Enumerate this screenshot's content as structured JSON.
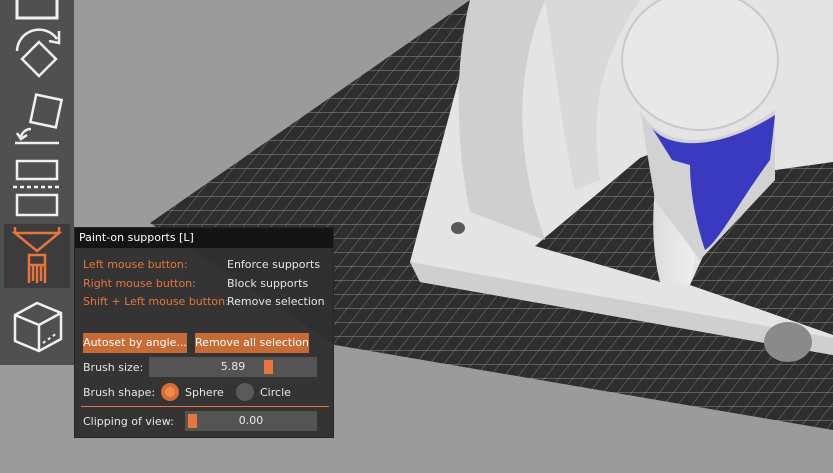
{
  "panel": {
    "title": "Paint-on supports [L]",
    "hints": [
      {
        "key": "Left mouse button:",
        "value": "Enforce supports"
      },
      {
        "key": "Right mouse button:",
        "value": "Block supports"
      },
      {
        "key": "Shift + Left mouse button:",
        "value": "Remove selection"
      }
    ],
    "autoset_label": "Autoset by angle...",
    "remove_all_label": "Remove all selection",
    "brush_size_label": "Brush size:",
    "brush_size_value": "5.89",
    "brush_size_fraction": 0.72,
    "brush_shape_label": "Brush shape:",
    "shape_options": [
      "Sphere",
      "Circle"
    ],
    "selected_shape": "Sphere",
    "clipping_label": "Clipping of view:",
    "clipping_value": "0.00",
    "clipping_fraction": 0.0
  },
  "toolbar": {
    "tools": [
      "move-icon",
      "rotate-icon",
      "place-on-face-icon",
      "cut-icon",
      "paint-supports-icon",
      "seam-icon"
    ],
    "active_tool": "paint-supports-icon"
  },
  "colors": {
    "accent": "#e8753a",
    "toolbar_bg": "#505050",
    "panel_bg": "#303030",
    "bed_bg": "#2f2f2f",
    "model": "#e6e6e6",
    "painted": "#3a3ac0"
  }
}
